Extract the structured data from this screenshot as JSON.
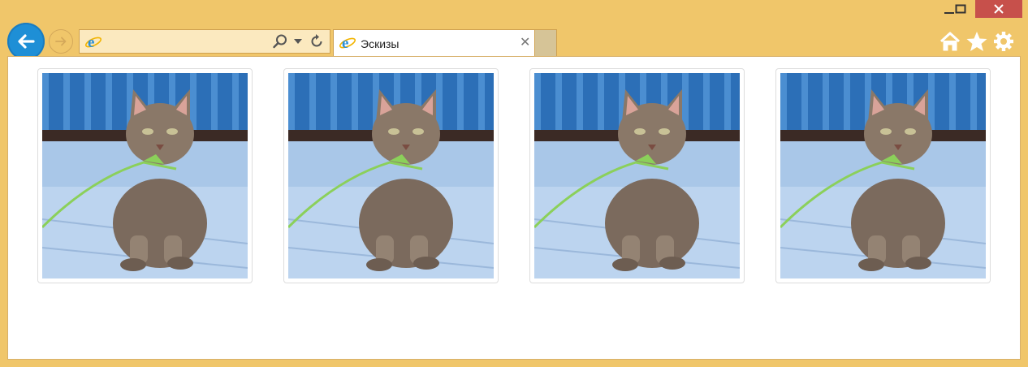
{
  "window": {
    "controls": [
      "minimize",
      "maximize",
      "close"
    ]
  },
  "toolbar": {
    "back_icon": "arrow-left-icon",
    "forward_icon": "arrow-right-icon",
    "address": {
      "value": "",
      "placeholder": ""
    },
    "right_icons": [
      "home-icon",
      "star-icon",
      "gear-icon"
    ]
  },
  "tab": {
    "title": "Эскизы",
    "close_label": "✕"
  },
  "page": {
    "thumbnails": [
      {
        "alt": "kitten-photo"
      },
      {
        "alt": "kitten-photo"
      },
      {
        "alt": "kitten-photo"
      },
      {
        "alt": "kitten-photo"
      }
    ]
  },
  "colors": {
    "frame": "#f0c66a",
    "close_button": "#c7504b",
    "back_button": "#1e8fd6",
    "address_bg": "#fbe9bf",
    "thumb_border": "#dddddd"
  }
}
